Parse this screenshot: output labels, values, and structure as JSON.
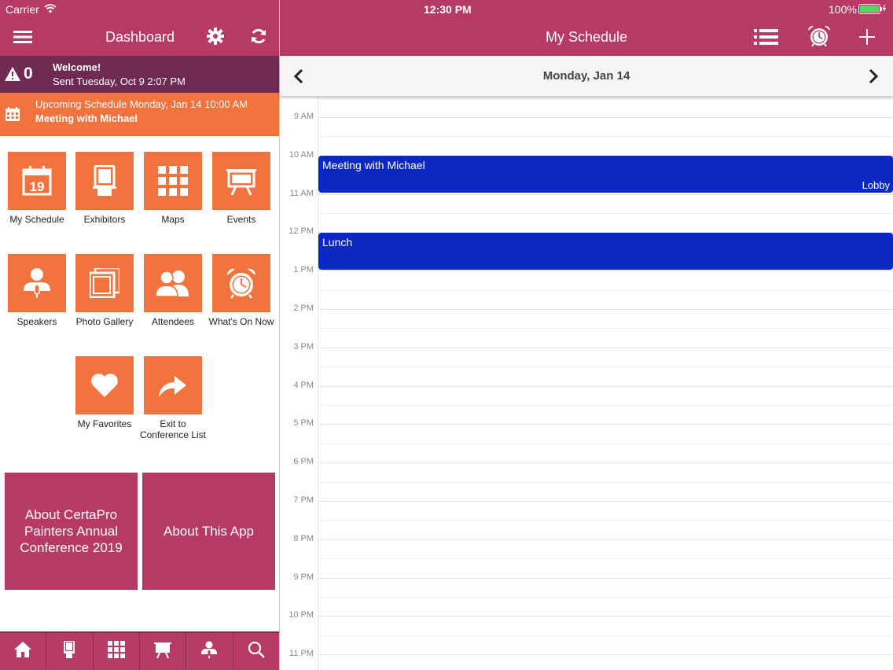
{
  "status": {
    "carrier": "Carrier",
    "time": "12:30 PM",
    "battery": "100%"
  },
  "left": {
    "title": "Dashboard",
    "welcome": {
      "count": "0",
      "title": "Welcome!",
      "subtitle": "Sent Tuesday, Oct 9 2:07 PM"
    },
    "upcoming": {
      "line1": "Upcoming Schedule Monday, Jan 14 10:00 AM",
      "line2": "Meeting with Michael"
    },
    "tiles": [
      {
        "label": "My Schedule",
        "icon": "calendar-icon",
        "day": "19"
      },
      {
        "label": "Exhibitors",
        "icon": "kiosk-icon"
      },
      {
        "label": "Maps",
        "icon": "grid-icon"
      },
      {
        "label": "Events",
        "icon": "easel-icon"
      },
      {
        "label": "Speakers",
        "icon": "speaker-icon"
      },
      {
        "label": "Photo Gallery",
        "icon": "photos-icon"
      },
      {
        "label": "Attendees",
        "icon": "people-icon"
      },
      {
        "label": "What's On Now",
        "icon": "alarm-clock-icon"
      },
      {
        "label": "My Favorites",
        "icon": "heart-icon"
      },
      {
        "label": "Exit to Conference List",
        "icon": "share-arrow-icon"
      }
    ],
    "about_conf": "About CertaPro Painters Annual Conference 2019",
    "about_app": "About This App",
    "tabbar": [
      "home-icon",
      "kiosk-icon",
      "grid-icon",
      "easel-icon",
      "speaker-icon",
      "search-icon"
    ]
  },
  "right": {
    "title": "My Schedule",
    "day": "Monday, Jan 14",
    "hours": [
      "9 AM",
      "10 AM",
      "11 AM",
      "12 PM",
      "1 PM",
      "2 PM",
      "3 PM",
      "4 PM",
      "5 PM",
      "6 PM",
      "7 PM",
      "8 PM",
      "9 PM",
      "10 PM",
      "11 PM"
    ],
    "events": [
      {
        "title": "Meeting with Michael",
        "location": "Lobby"
      },
      {
        "title": "Lunch",
        "location": ""
      }
    ]
  },
  "colors": {
    "header": "#b73a63",
    "tile": "#f2733e",
    "welcome": "#6f2a52",
    "event": "#0b29c2"
  }
}
